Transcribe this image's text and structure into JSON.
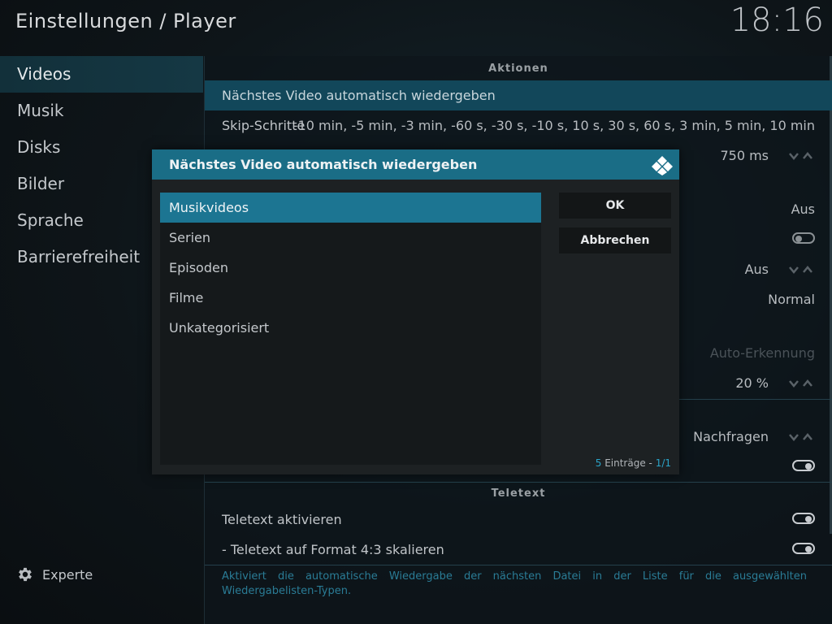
{
  "header": {
    "title": "Einstellungen / Player",
    "clock": "18:16"
  },
  "sidebar": {
    "items": [
      {
        "label": "Videos"
      },
      {
        "label": "Musik"
      },
      {
        "label": "Disks"
      },
      {
        "label": "Bilder"
      },
      {
        "label": "Sprache"
      },
      {
        "label": "Barrierefreiheit"
      }
    ],
    "expert_label": "Experte"
  },
  "panel": {
    "section_actions": "Aktionen",
    "row_autoplay": "Nächstes Video automatisch wiedergeben",
    "row_skip_label": "Skip-Schritte",
    "row_skip_value": "-10 min, -5 min, -3 min, -60 s, -30 s, -10 s, 10 s, 30 s, 60 s, 3 min, 5 min, 10 min",
    "row_delay_value": "750 ms",
    "row_aus1": "Aus",
    "row_aus2": "Aus",
    "row_normal": "Normal",
    "row_auto": "Auto-Erkennung",
    "row_pct": "20 %",
    "row_ask": "Nachfragen",
    "section_teletext": "Teletext",
    "row_teletext": "Teletext aktivieren",
    "row_teletext43": "- Teletext auf Format 4:3 skalieren",
    "description": "Aktiviert die automatische Wiedergabe der nächsten Datei in der Liste für die ausgewählten Wiedergabelisten-Typen."
  },
  "dialog": {
    "title": "Nächstes Video automatisch wiedergeben",
    "options": [
      {
        "label": "Musikvideos"
      },
      {
        "label": "Serien"
      },
      {
        "label": "Episoden"
      },
      {
        "label": "Filme"
      },
      {
        "label": "Unkategorisiert"
      }
    ],
    "ok_label": "OK",
    "cancel_label": "Abbrechen",
    "footer_count": "5",
    "footer_text": " Einträge - ",
    "footer_page": "1/1"
  },
  "colors": {
    "accent": "#1a6d86",
    "selection": "#1c7592",
    "focus_row": "#12475a"
  }
}
